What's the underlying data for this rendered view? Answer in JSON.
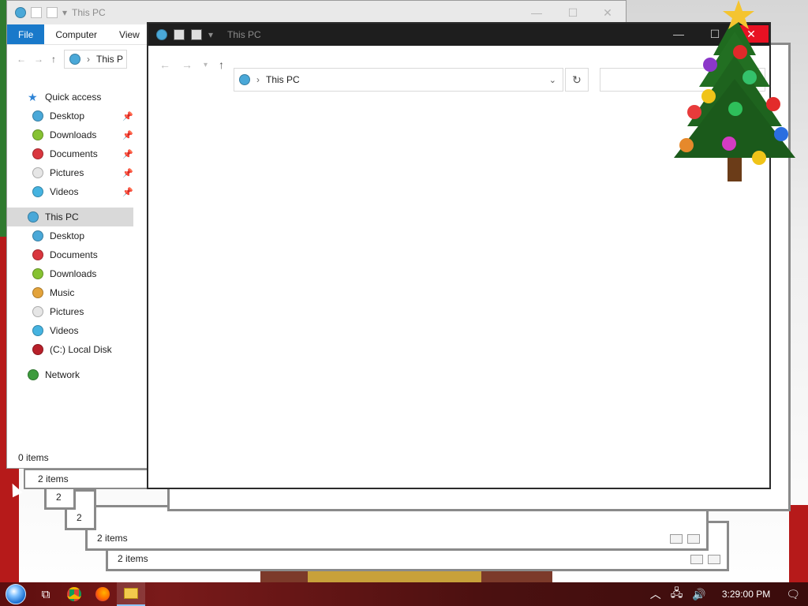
{
  "back_window": {
    "title": "This PC",
    "tabs": [
      "File",
      "Computer",
      "View"
    ],
    "address": "This P",
    "status": "0 items",
    "quick_access": {
      "label": "Quick access",
      "items": [
        {
          "label": "Desktop",
          "icon": "desktop-icon",
          "color": "#4aa8d8",
          "pinned": true
        },
        {
          "label": "Downloads",
          "icon": "downloads-icon",
          "color": "#86c232",
          "pinned": true
        },
        {
          "label": "Documents",
          "icon": "documents-icon",
          "color": "#d9363e",
          "pinned": true
        },
        {
          "label": "Pictures",
          "icon": "pictures-icon",
          "color": "#e6e6e6",
          "pinned": true
        },
        {
          "label": "Videos",
          "icon": "videos-icon",
          "color": "#45b3e0",
          "pinned": true
        }
      ]
    },
    "this_pc": {
      "label": "This PC",
      "items": [
        {
          "label": "Desktop",
          "icon": "desktop-icon",
          "color": "#4aa8d8"
        },
        {
          "label": "Documents",
          "icon": "documents-icon",
          "color": "#d9363e"
        },
        {
          "label": "Downloads",
          "icon": "downloads-icon",
          "color": "#86c232"
        },
        {
          "label": "Music",
          "icon": "music-icon",
          "color": "#e3a33b"
        },
        {
          "label": "Pictures",
          "icon": "pictures-icon",
          "color": "#e6e6e6"
        },
        {
          "label": "Videos",
          "icon": "videos-icon",
          "color": "#45b3e0"
        },
        {
          "label": "(C:) Local Disk",
          "icon": "disk-icon",
          "color": "#b8202a"
        }
      ]
    },
    "network": {
      "label": "Network",
      "color": "#3d9b3d"
    }
  },
  "ghost_windows": [
    {
      "status": "2 items"
    },
    {
      "status": "2"
    },
    {
      "status": "2"
    },
    {
      "status": "2 items"
    },
    {
      "status": "2 items"
    }
  ],
  "front_window": {
    "title": "This PC",
    "address": "This PC",
    "search_placeholder": ""
  },
  "taskbar": {
    "apps": [
      "task-view-icon",
      "chrome-icon",
      "firefox-icon",
      "file-explorer-icon"
    ],
    "clock": "3:29:00 PM"
  }
}
